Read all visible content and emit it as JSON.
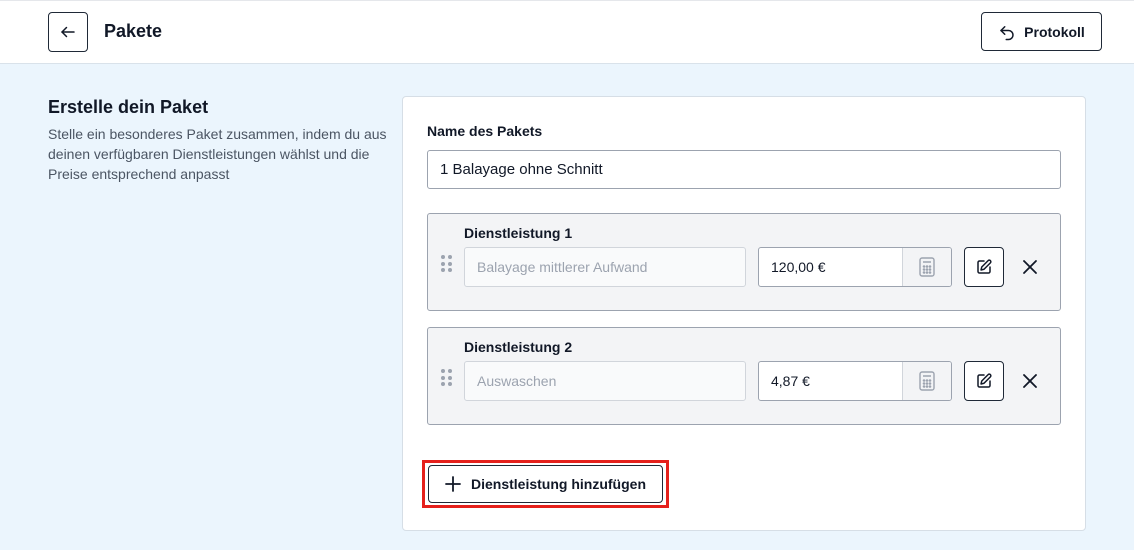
{
  "header": {
    "title": "Pakete",
    "back_icon": "arrow-left-icon",
    "protocol_label": "Protokoll",
    "protocol_icon": "undo-arrow-icon"
  },
  "intro": {
    "title": "Erstelle dein Paket",
    "description": "Stelle ein besonderes Paket zusammen, indem du aus deinen verfügbaren Dienstleistungen wählst und die Preise entsprechend anpasst"
  },
  "form": {
    "name_label": "Name des Pakets",
    "name_value": "1 Balayage ohne Schnitt",
    "services": [
      {
        "label": "Dienstleistung 1",
        "service_placeholder": "Balayage mittlerer Aufwand",
        "price": "120,00 €"
      },
      {
        "label": "Dienstleistung 2",
        "service_placeholder": "Auswaschen",
        "price": "4,87 €"
      }
    ],
    "add_service_label": "Dienstleistung hinzufügen"
  },
  "colors": {
    "page_background": "#ebf5fd",
    "highlight": "#e5201c"
  }
}
